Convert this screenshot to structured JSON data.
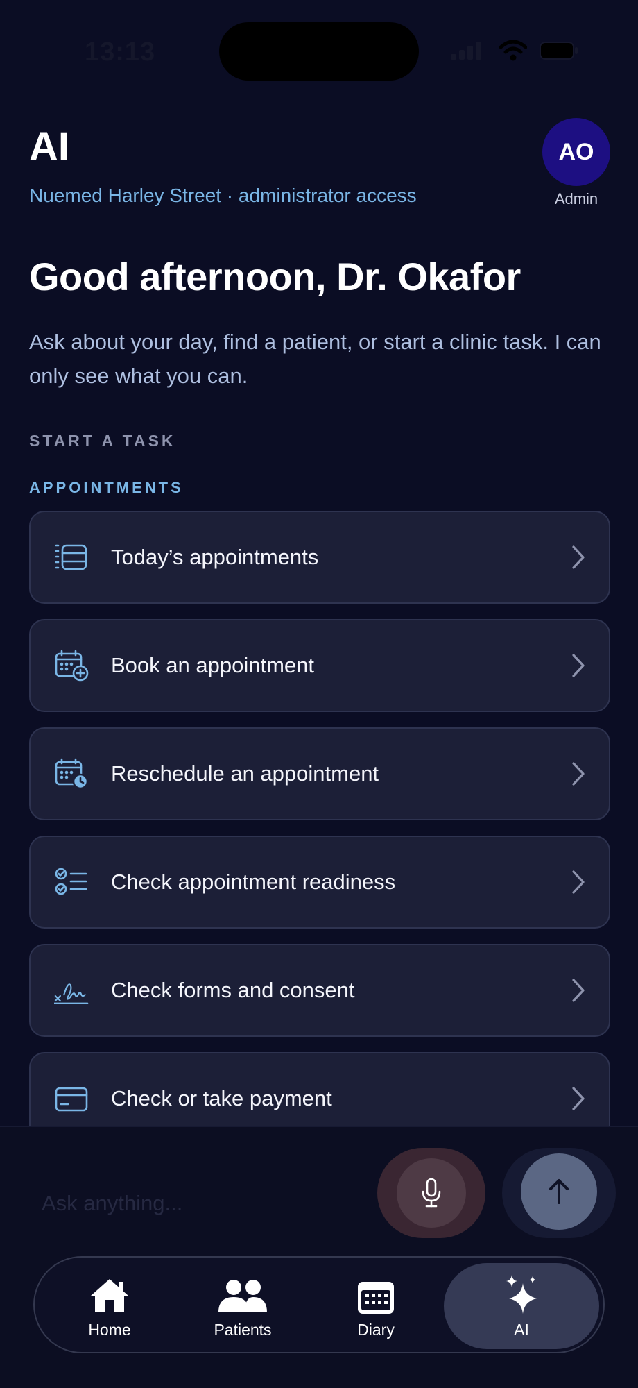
{
  "status_bar": {
    "time": "13:13"
  },
  "header": {
    "title": "AI",
    "subtitle": "Nuemed Harley Street · administrator access",
    "avatar_initials": "AO",
    "avatar_role": "Admin"
  },
  "greeting": "Good afternoon, Dr. Okafor",
  "intro": "Ask about your day, find a patient, or start a clinic task. I can only see what you can.",
  "section_label": "START A TASK",
  "group_label": "APPOINTMENTS",
  "tasks": [
    {
      "label": "Today’s appointments",
      "icon": "agenda-list-icon"
    },
    {
      "label": "Book an appointment",
      "icon": "calendar-add-icon"
    },
    {
      "label": "Reschedule an appointment",
      "icon": "calendar-clock-icon"
    },
    {
      "label": "Check appointment readiness",
      "icon": "checklist-icon"
    },
    {
      "label": "Check forms and consent",
      "icon": "signature-icon"
    },
    {
      "label": "Check or take payment",
      "icon": "credit-card-icon"
    }
  ],
  "composer": {
    "placeholder": "Ask anything..."
  },
  "tabs": [
    {
      "label": "Home",
      "icon": "house-icon"
    },
    {
      "label": "Patients",
      "icon": "people-icon"
    },
    {
      "label": "Diary",
      "icon": "calendar-icon"
    },
    {
      "label": "AI",
      "icon": "sparkles-icon",
      "active": true
    }
  ],
  "colors": {
    "background": "#0b0d24",
    "card": "#1c1f37",
    "accent_blue": "#7ab6e6",
    "avatar": "#1d0f82"
  }
}
